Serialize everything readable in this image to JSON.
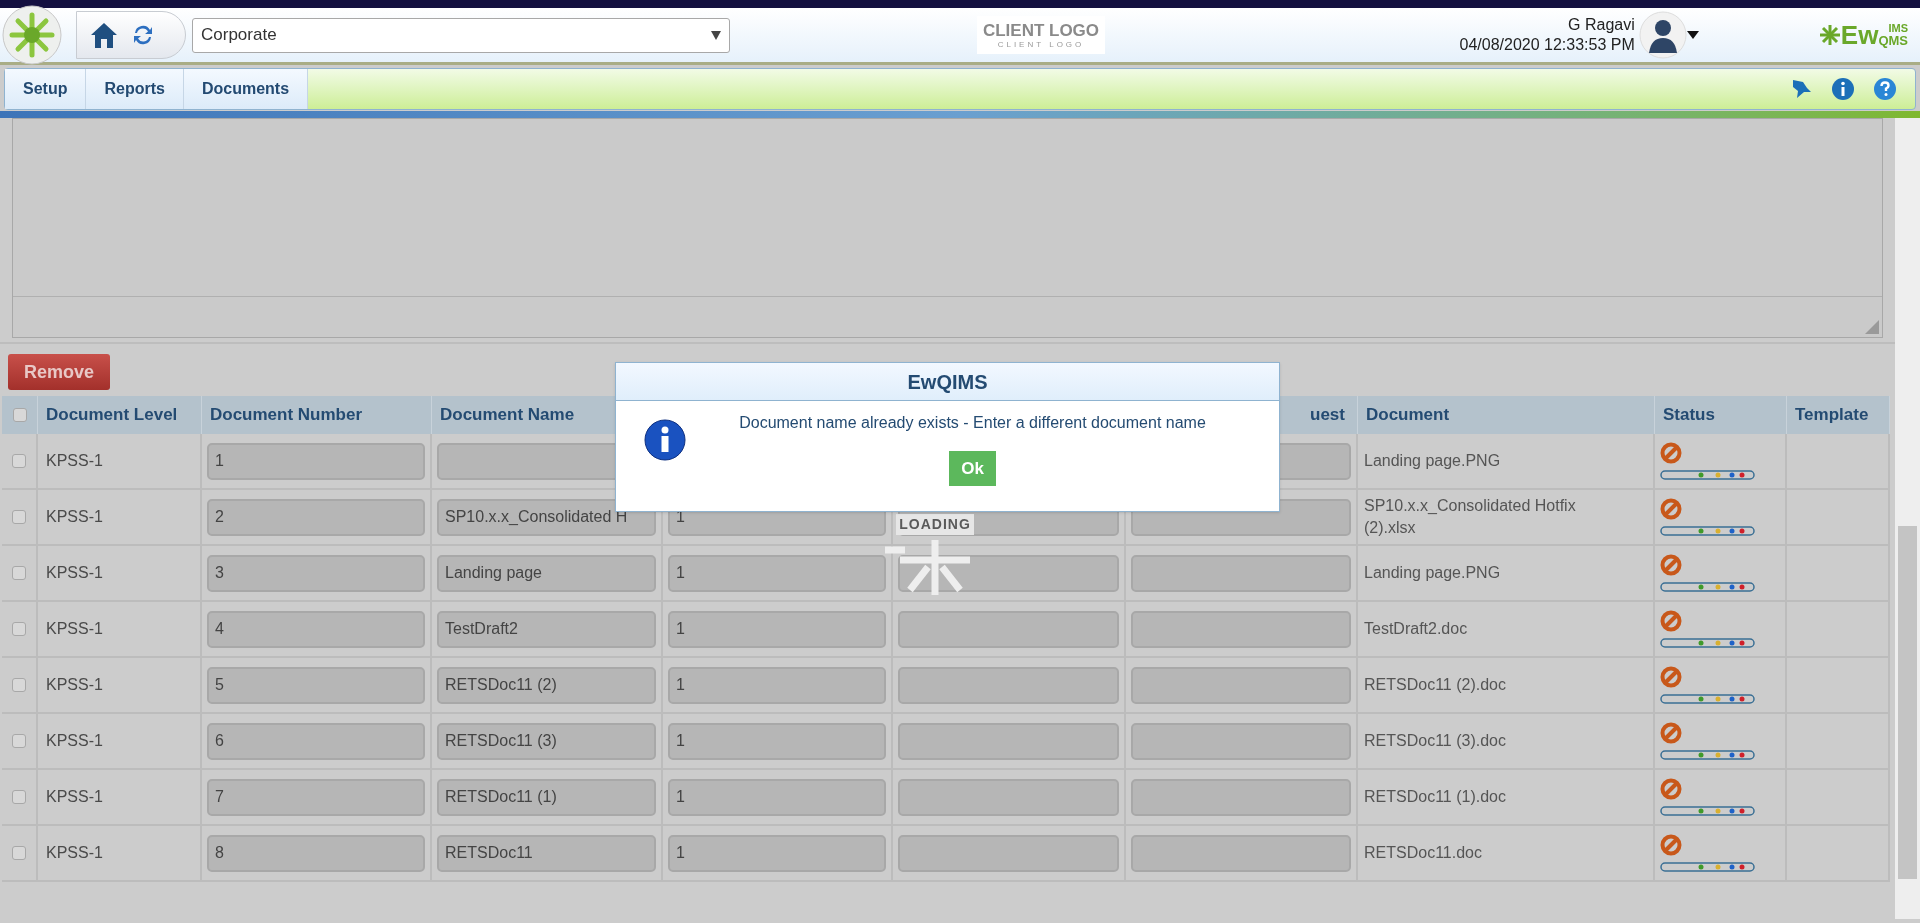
{
  "header": {
    "location": "Corporate",
    "client_logo": {
      "title": "CLIENT LOGO",
      "subtitle": "CLIENT LOGO"
    },
    "user_name": "G Ragavi",
    "datetime": "04/08/2020 12:33:53 PM",
    "brand": {
      "main": "Ew",
      "top": "IMS",
      "bottom": "QMS"
    }
  },
  "nav_tabs": [
    "Setup",
    "Reports",
    "Documents"
  ],
  "remove_button": "Remove",
  "table": {
    "select_all_checked": false,
    "columns": {
      "document_level": "Document Level",
      "document_number": "Document Number",
      "document_name": "Document Name",
      "column_6": "uest",
      "document": "Document",
      "status": "Status",
      "template": "Template"
    },
    "rows": [
      {
        "checked": false,
        "document_level": "KPSS-1",
        "document_number": "1",
        "document": "Landing page.PNG"
      },
      {
        "checked": false,
        "document_level": "KPSS-1",
        "document_number": "2",
        "document_name": "SP10.x.x_Consolidated H",
        "column_4": "1",
        "document": "SP10.x.x_Consolidated Hotfix (2).xlsx"
      },
      {
        "checked": false,
        "document_level": "KPSS-1",
        "document_number": "3",
        "document_name": "Landing page",
        "column_4": "1",
        "document": "Landing page.PNG"
      },
      {
        "checked": false,
        "document_level": "KPSS-1",
        "document_number": "4",
        "document_name": "TestDraft2",
        "column_4": "1",
        "document": "TestDraft2.doc"
      },
      {
        "checked": false,
        "document_level": "KPSS-1",
        "document_number": "5",
        "document_name": "RETSDoc11 (2)",
        "column_4": "1",
        "document": "RETSDoc11 (2).doc"
      },
      {
        "checked": false,
        "document_level": "KPSS-1",
        "document_number": "6",
        "document_name": "RETSDoc11 (3)",
        "column_4": "1",
        "document": "RETSDoc11 (3).doc"
      },
      {
        "checked": false,
        "document_level": "KPSS-1",
        "document_number": "7",
        "document_name": "RETSDoc11 (1)",
        "column_4": "1",
        "document": "RETSDoc11 (1).doc"
      },
      {
        "checked": false,
        "document_level": "KPSS-1",
        "document_number": "8",
        "document_name": "RETSDoc11",
        "column_4": "1",
        "document": "RETSDoc11.doc"
      }
    ]
  },
  "loading_label": "LOADING",
  "dialog": {
    "title": "EwQIMS",
    "message": "Document name already exists - Enter a different document name",
    "button": "Ok"
  }
}
